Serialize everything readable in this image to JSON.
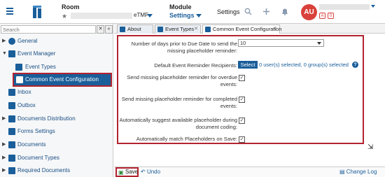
{
  "header": {
    "room_label": "Room",
    "room_value": "eTMF",
    "module_label": "Module",
    "module_value": "Settings",
    "page_title": "Settings",
    "avatar_initials": "AU",
    "badges": [
      "A",
      "0"
    ]
  },
  "sidebar": {
    "search_placeholder": "Search",
    "collapse_label": "«",
    "items": [
      {
        "label": "General"
      },
      {
        "label": "Event Manager"
      },
      {
        "label": "Event Types"
      },
      {
        "label": "Common Event Configuration"
      },
      {
        "label": "Inbox"
      },
      {
        "label": "Outbox"
      },
      {
        "label": "Documents Distribution"
      },
      {
        "label": "Forms Settings"
      },
      {
        "label": "Documents"
      },
      {
        "label": "Document Types"
      },
      {
        "label": "Required Documents"
      }
    ]
  },
  "tabs": [
    {
      "label": "About"
    },
    {
      "label": "Event Types"
    },
    {
      "label": "Common Event Configuration"
    }
  ],
  "form": {
    "days_label": "Number of days prior to Due Date to send the missing placeholder reminder:",
    "days_value": "10",
    "recipients_label": "Default Event Reminder Recipients:",
    "select_button": "Select",
    "recipients_summary": "0 user(s) selected, 0 group(s) selected",
    "overdue_label": "Send missing placeholder reminder for overdue events:",
    "completed_label": "Send missing placeholder reminder for completed events:",
    "suggest_label": "Automatically suggest available placeholder during document coding:",
    "match_label": "Automatically match Placeholders on Save:"
  },
  "footer": {
    "save_label": "Save",
    "undo_label": "Undo",
    "changelog_label": "Change Log"
  }
}
